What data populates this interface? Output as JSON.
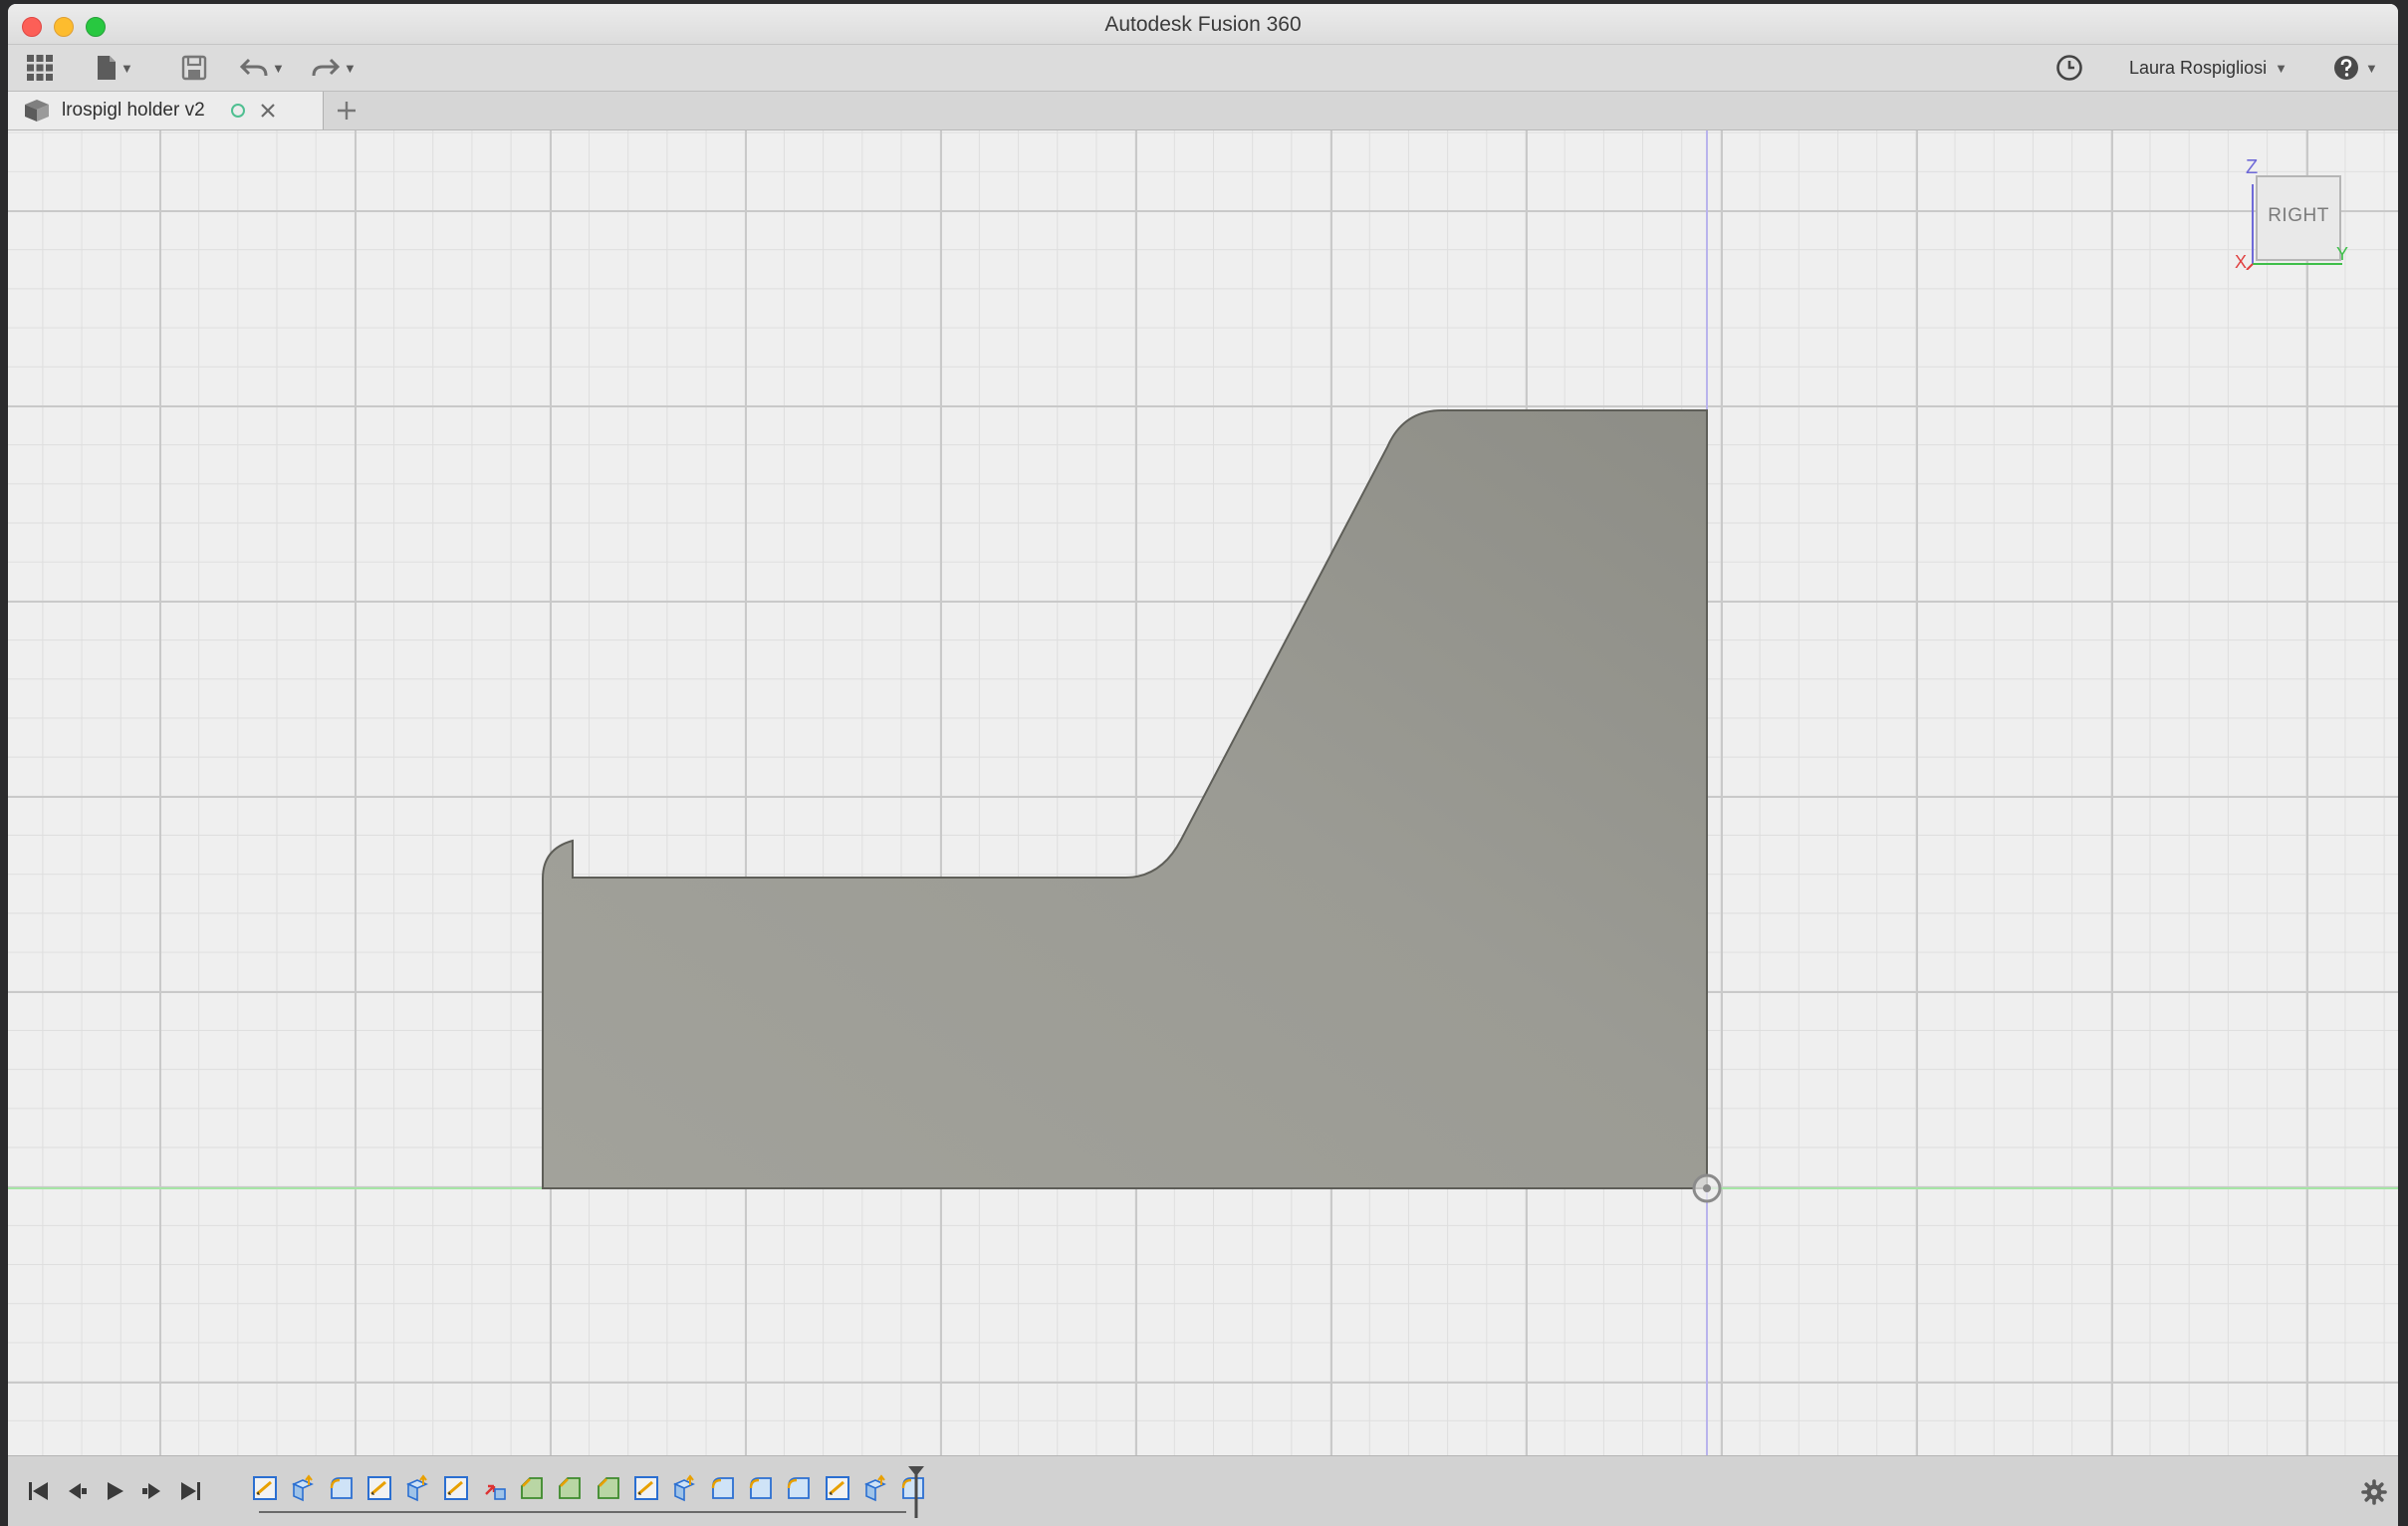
{
  "window": {
    "title": "Autodesk Fusion 360"
  },
  "toolbar": {
    "apps_icon": "grid-icon",
    "file_icon": "file-icon",
    "save_icon": "save-icon",
    "undo_icon": "undo-icon",
    "redo_icon": "redo-icon",
    "job_status_icon": "clock-icon",
    "user_name": "Laura Rospigliosi",
    "help_icon": "help-icon"
  },
  "document_tab": {
    "label": "lrospigl holder v2",
    "status_icon": "circle-icon",
    "close_icon": "close-icon",
    "new_tab_icon": "plus-icon"
  },
  "viewcube": {
    "face_label": "RIGHT",
    "axis_z": "Z",
    "axis_x": "X",
    "axis_y": "Y"
  },
  "timeline": {
    "controls": [
      "skip-to-start-icon",
      "step-back-icon",
      "play-icon",
      "step-forward-icon",
      "skip-to-end-icon"
    ],
    "features": [
      "sketch",
      "extrude",
      "fillet",
      "sketch",
      "extrude",
      "sketch",
      "move",
      "chamfer",
      "chamfer",
      "chamfer",
      "sketch",
      "extrude",
      "fillet",
      "fillet",
      "fillet",
      "sketch",
      "extrude",
      "fillet"
    ],
    "settings_icon": "gear-icon"
  },
  "colors": {
    "part_fill": "#9d9d96",
    "grid_major": "#c9c9c9",
    "grid_minor": "#dedede",
    "axis_vertical": "#b9b3ec",
    "axis_horizontal": "#a6e5a6"
  }
}
